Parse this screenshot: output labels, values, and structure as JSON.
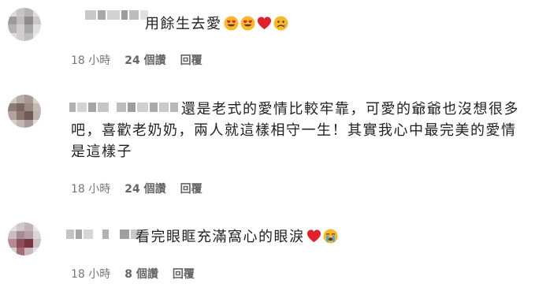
{
  "comments": [
    {
      "text": "用餘生去愛",
      "emojis": [
        "heart-eyes-emoji",
        "heart-eyes-emoji",
        "red-heart-emoji",
        "sad-face-emoji"
      ],
      "time": "18 小時",
      "likes": "24 個讚",
      "reply": "回覆"
    },
    {
      "text": "還是老式的愛情比較牢靠，可愛的爺爺也沒想很多吧，喜歡老奶奶，兩人就這樣相守一生！其實我心中最完美的愛情是這樣子",
      "emojis": [],
      "time": "18 小時",
      "likes": "24 個讚",
      "reply": "回覆"
    },
    {
      "text": "看完眼眶充滿窩心的眼淚",
      "emojis": [
        "red-heart-emoji",
        "crying-face-emoji"
      ],
      "time": "18 小時",
      "likes": "8 個讚",
      "reply": "回覆"
    }
  ],
  "colors": {
    "text": "#1f1f1f",
    "meta": "#666666",
    "heart": "#e0202c",
    "emoji_yellow": "#f7b928"
  }
}
